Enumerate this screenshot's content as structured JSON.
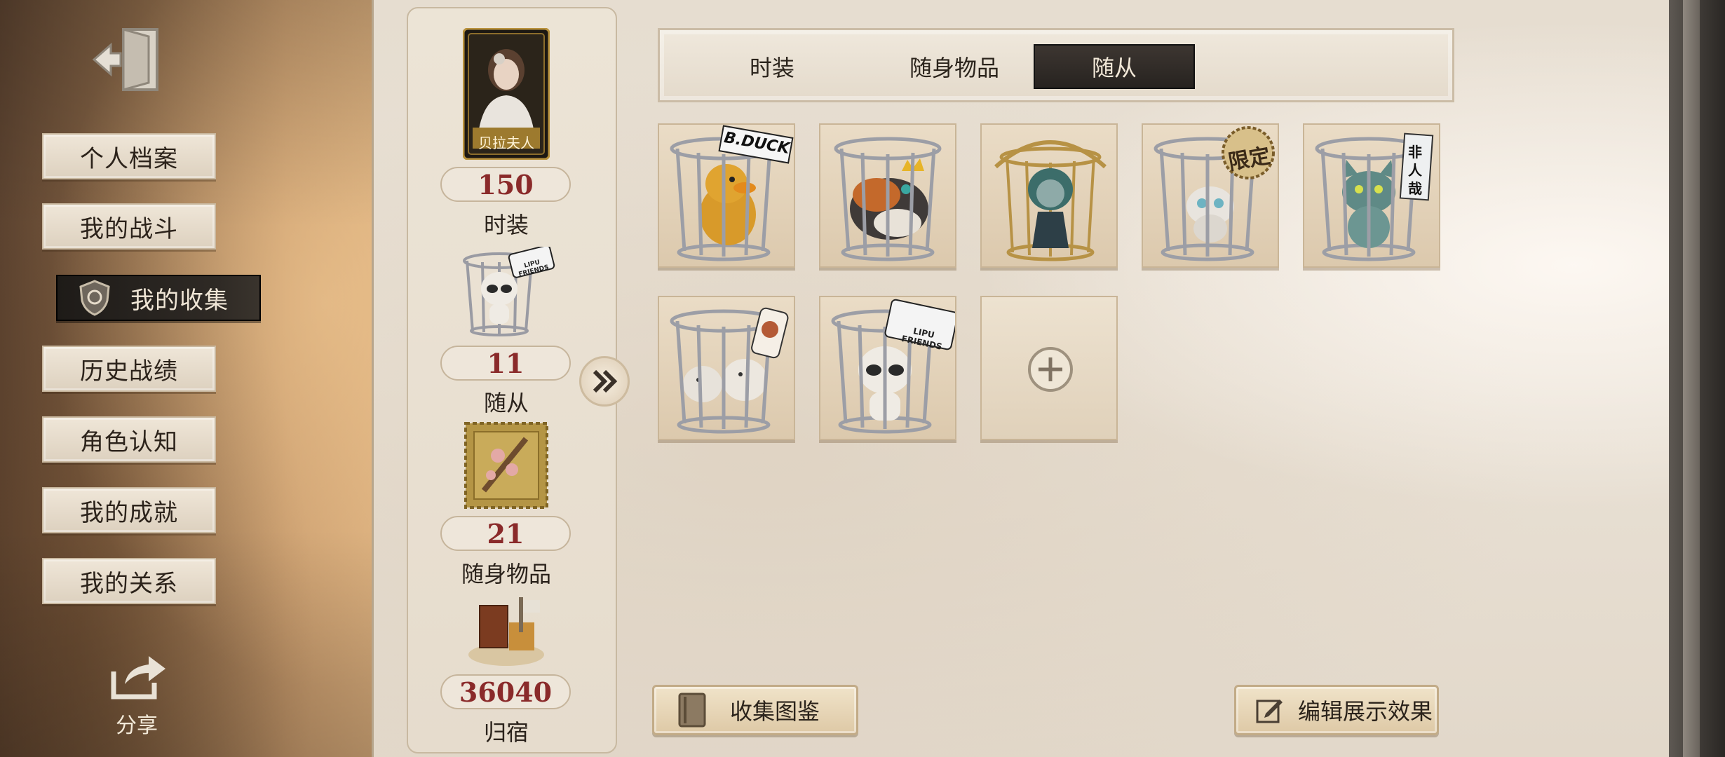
{
  "left_menu": {
    "items": [
      {
        "label": "个人档案"
      },
      {
        "label": "我的战斗"
      },
      {
        "label": "我的收集"
      },
      {
        "label": "历史战绩"
      },
      {
        "label": "角色认知"
      },
      {
        "label": "我的成就"
      },
      {
        "label": "我的关系"
      }
    ],
    "active_index": 2,
    "share_label": "分享"
  },
  "stats": {
    "character_card_name": "贝拉夫人",
    "items": [
      {
        "count": "150",
        "label": "时装"
      },
      {
        "count": "11",
        "label": "随从"
      },
      {
        "count": "21",
        "label": "随身物品"
      },
      {
        "count": "36040",
        "label": "归宿"
      }
    ]
  },
  "tabs": {
    "items": [
      {
        "label": "时装"
      },
      {
        "label": "随身物品"
      },
      {
        "label": "随从"
      }
    ],
    "active_index": 2
  },
  "pets": [
    {
      "name": "duck-pet",
      "badge": "B.DUCK"
    },
    {
      "name": "crowned-cat-pet",
      "badge": ""
    },
    {
      "name": "medusa-doll-pet",
      "badge": ""
    },
    {
      "name": "white-cat-pet",
      "badge": "限定"
    },
    {
      "name": "teal-cat-pet",
      "badge": "非人哉"
    },
    {
      "name": "chicks-pet",
      "badge": ""
    },
    {
      "name": "lipu-doll-pet",
      "badge": "LIPU FRIENDS"
    }
  ],
  "mini_badge": "LIPU FRIENDS",
  "bottom": {
    "collection_label": "收集图鉴",
    "edit_label": "编辑展示效果"
  },
  "colors": {
    "count_text": "#8a2a2a",
    "active_tab_bg": "#2f2a26",
    "active_menu_bg": "#26221e"
  }
}
